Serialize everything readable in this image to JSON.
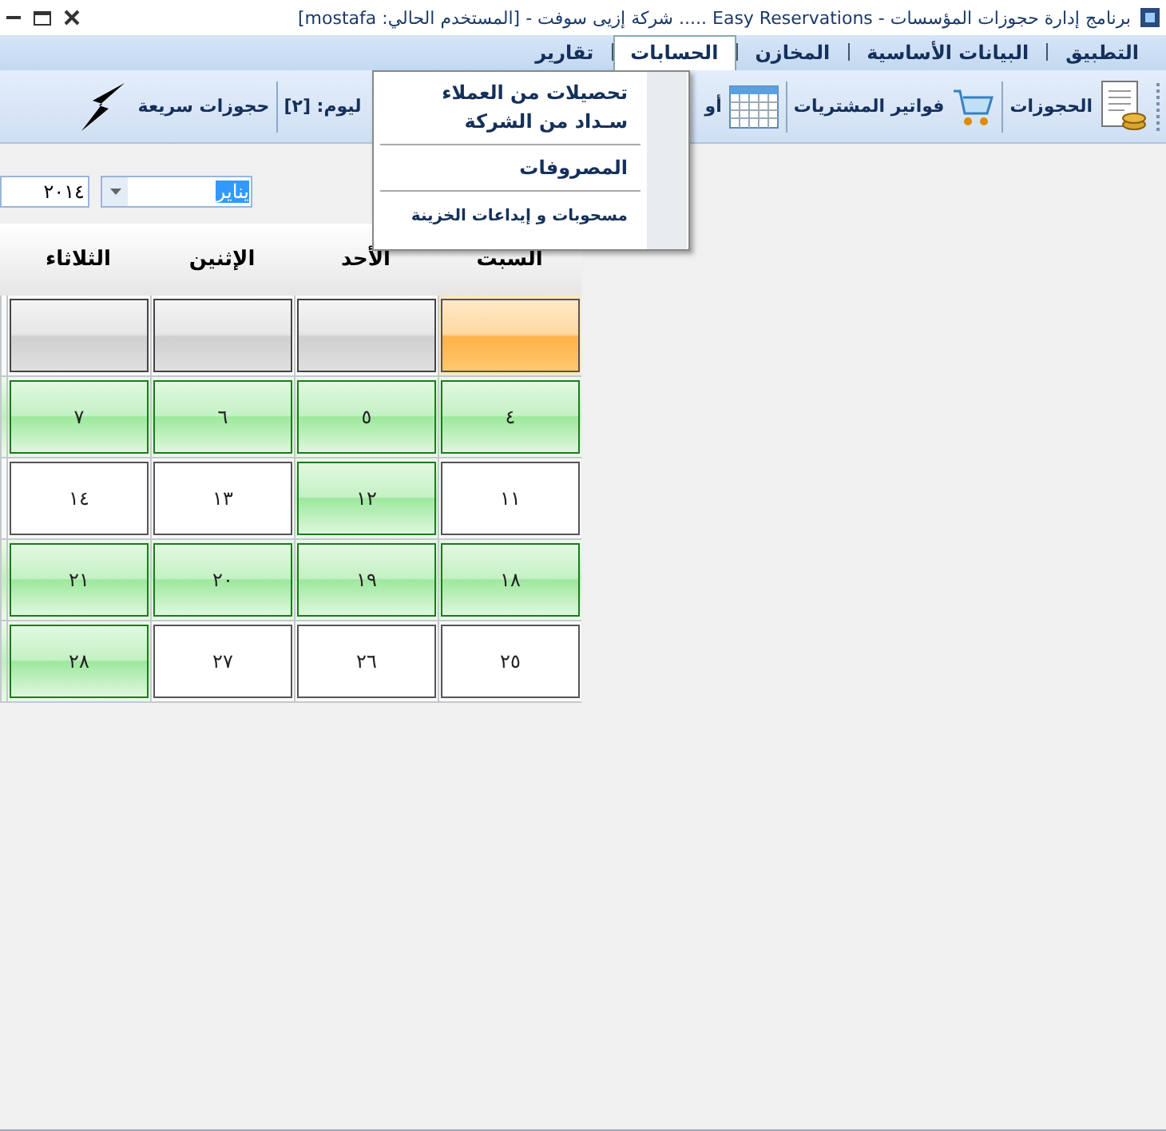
{
  "window": {
    "title": "برنامج إدارة حجوزات المؤسسات - Easy  Reservations ..... شركة إزيى سوفت - [المستخدم الحالي: mostafa]"
  },
  "menu": [
    {
      "label": "التطبيق",
      "selected": false
    },
    {
      "label": "البيانات الأساسية",
      "selected": false
    },
    {
      "label": "المخازن",
      "selected": false
    },
    {
      "label": "الحسابات",
      "selected": true
    },
    {
      "label": "تقارير",
      "selected": false
    }
  ],
  "dropdown": [
    {
      "kind": "item",
      "label": "تحصيلات من العملاء"
    },
    {
      "kind": "item",
      "label": "سـداد  من الشركة"
    },
    {
      "kind": "separator"
    },
    {
      "kind": "item",
      "label": "المصروفات"
    },
    {
      "kind": "separator"
    },
    {
      "kind": "minor",
      "label": "مسحوبات و إيداعات الخزينة"
    }
  ],
  "toolbar": [
    {
      "label": "الحجوزات"
    },
    {
      "label": "فواتير المشتريات"
    },
    {
      "label": "أو"
    },
    {
      "label": "ليوم: [٢]"
    },
    {
      "label": "حجوزات سريعة"
    }
  ],
  "date": {
    "month": "يناير",
    "year": "٢٠١٤"
  },
  "calendar": {
    "days": [
      "السبت",
      "الأحد",
      "الإثنين",
      "الثلاثاء"
    ],
    "weeks": [
      [
        {
          "kind": "current"
        },
        {
          "kind": "empty"
        },
        {
          "kind": "empty"
        },
        {
          "kind": "empty"
        }
      ],
      [
        {
          "day": "٤",
          "kind": "booked"
        },
        {
          "day": "٥",
          "kind": "booked"
        },
        {
          "day": "٦",
          "kind": "booked"
        },
        {
          "day": "٧",
          "kind": "booked"
        }
      ],
      [
        {
          "day": "١١",
          "kind": "free"
        },
        {
          "day": "١٢",
          "kind": "booked"
        },
        {
          "day": "١٣",
          "kind": "free"
        },
        {
          "day": "١٤",
          "kind": "free"
        }
      ],
      [
        {
          "day": "١٨",
          "kind": "booked"
        },
        {
          "day": "١٩",
          "kind": "booked"
        },
        {
          "day": "٢٠",
          "kind": "booked"
        },
        {
          "day": "٢١",
          "kind": "booked"
        }
      ],
      [
        {
          "day": "٢٥",
          "kind": "free"
        },
        {
          "day": "٢٦",
          "kind": "free"
        },
        {
          "day": "٢٧",
          "kind": "free"
        },
        {
          "day": "٢٨",
          "kind": "booked"
        }
      ]
    ]
  }
}
